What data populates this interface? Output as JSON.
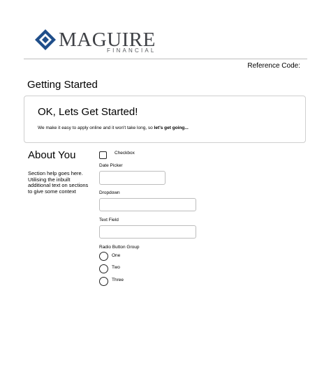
{
  "brand": {
    "name": "MAGUIRE",
    "tagline": "FINANCIAL",
    "color_primary": "#1f4e8a",
    "color_text": "#3f4146"
  },
  "header": {
    "reference_code_label": "Reference Code:"
  },
  "page": {
    "title": "Getting Started"
  },
  "intro": {
    "title": "OK, Lets Get Started!",
    "text": "We make it easy to apply online and it won't take long, so ",
    "text_bold": "let's get going..."
  },
  "section": {
    "title": "About You",
    "help": "Section help goes here. Utilising the inbuilt additional text on sections to give some context"
  },
  "form": {
    "checkbox": {
      "label": "Checkbox",
      "checked": false
    },
    "date_picker": {
      "label": "Date Picker",
      "value": ""
    },
    "dropdown": {
      "label": "Dropdown",
      "value": ""
    },
    "text_field": {
      "label": "Text Field",
      "value": ""
    },
    "radio_group": {
      "label": "Radio Button Group",
      "options": [
        "One",
        "Two",
        "Three"
      ]
    }
  }
}
